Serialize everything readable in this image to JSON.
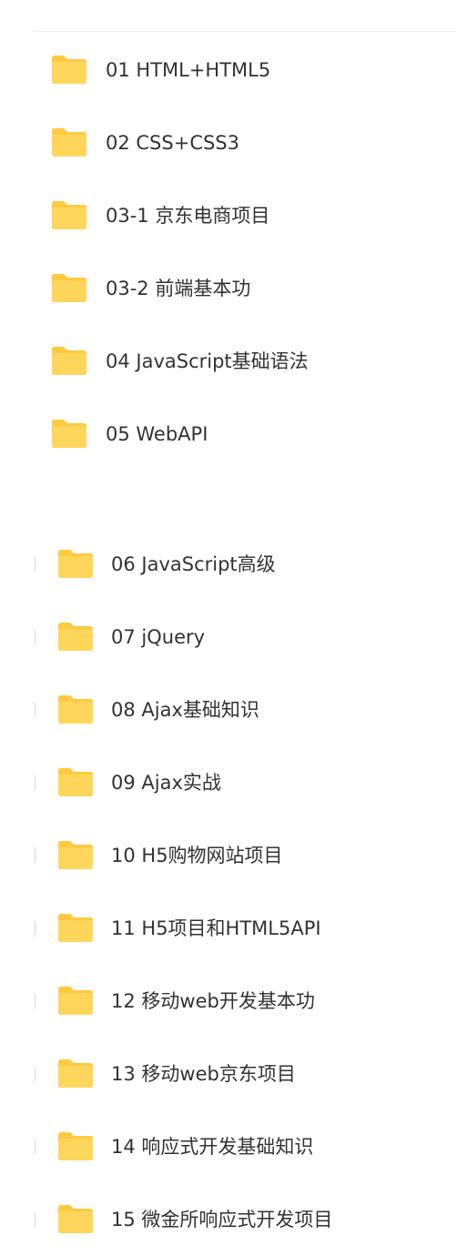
{
  "colors": {
    "folder": "#FFD65C",
    "folder_tab": "#FFC940",
    "text": "#333333"
  },
  "folder_icon": "folder-icon",
  "list_a": [
    {
      "label": "01 HTML+HTML5"
    },
    {
      "label": "02 CSS+CSS3"
    },
    {
      "label": "03-1 京东电商项目"
    },
    {
      "label": "03-2 前端基本功"
    },
    {
      "label": "04 JavaScript基础语法"
    },
    {
      "label": "05 WebAPI"
    }
  ],
  "list_b": [
    {
      "label": "06 JavaScript高级"
    },
    {
      "label": "07 jQuery"
    },
    {
      "label": "08 Ajax基础知识"
    },
    {
      "label": "09 Ajax实战"
    },
    {
      "label": "10 H5购物网站项目"
    },
    {
      "label": "11 H5项目和HTML5API"
    },
    {
      "label": "12 移动web开发基本功"
    },
    {
      "label": "13 移动web京东项目"
    },
    {
      "label": "14 响应式开发基础知识"
    },
    {
      "label": "15 微金所响应式开发项目"
    }
  ]
}
